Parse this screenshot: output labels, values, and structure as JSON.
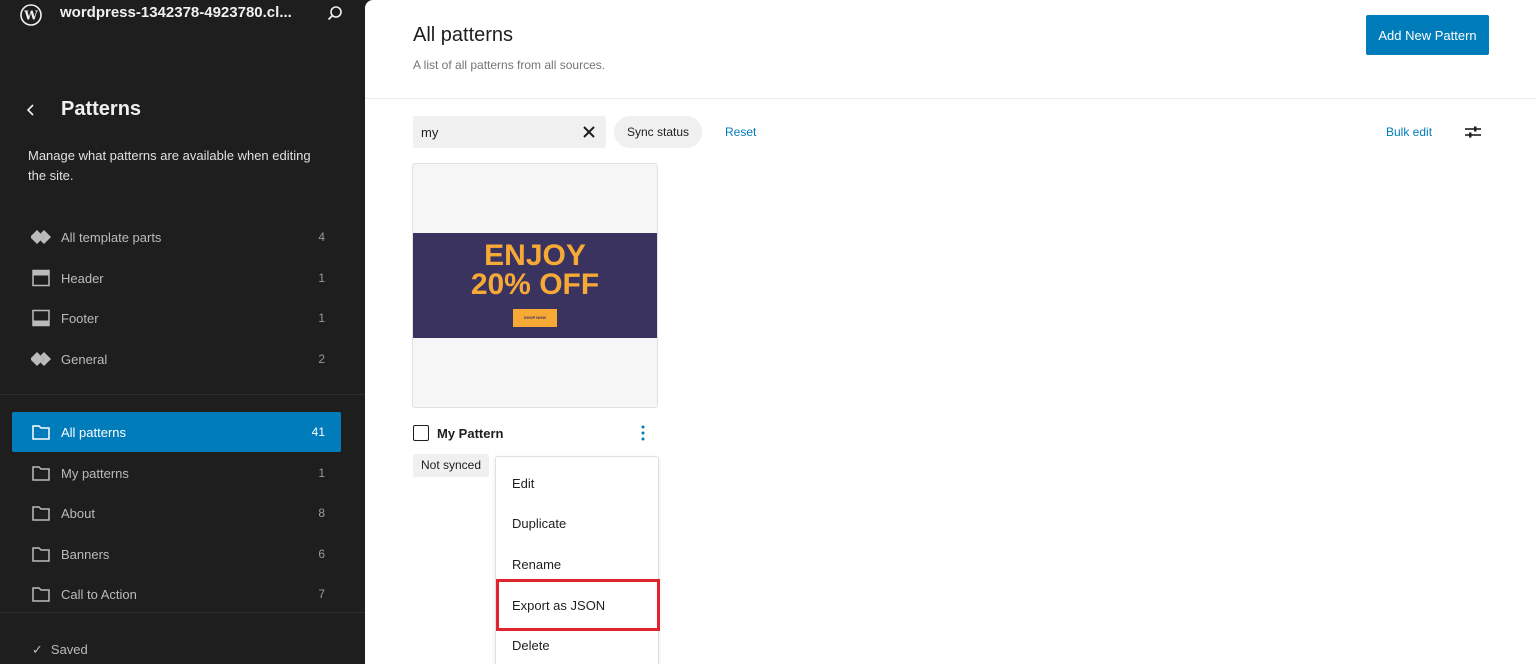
{
  "sidebar": {
    "site_title": "wordpress-1342378-4923780.cl...",
    "title": "Patterns",
    "description": "Manage what patterns are available when editing the site.",
    "template_parts": [
      {
        "label": "All template parts",
        "count": "4",
        "icon": "template-parts-icon"
      },
      {
        "label": "Header",
        "count": "1",
        "icon": "header-icon"
      },
      {
        "label": "Footer",
        "count": "1",
        "icon": "footer-icon"
      },
      {
        "label": "General",
        "count": "2",
        "icon": "template-parts-icon"
      }
    ],
    "pattern_categories": [
      {
        "label": "All patterns",
        "count": "41",
        "icon": "folder-icon",
        "active": true
      },
      {
        "label": "My patterns",
        "count": "1",
        "icon": "folder-icon"
      },
      {
        "label": "About",
        "count": "8",
        "icon": "folder-icon"
      },
      {
        "label": "Banners",
        "count": "6",
        "icon": "folder-icon"
      },
      {
        "label": "Call to Action",
        "count": "7",
        "icon": "folder-icon"
      }
    ],
    "saved_label": "Saved"
  },
  "main": {
    "title": "All patterns",
    "subtitle": "A list of all patterns from all sources.",
    "add_button": "Add New Pattern",
    "search_value": "my",
    "sync_status": "Sync status",
    "reset": "Reset",
    "bulk_edit": "Bulk edit",
    "card": {
      "preview_line1": "ENJOY",
      "preview_line2": "20% OFF",
      "preview_button": "SHOP NOW",
      "name": "My Pattern",
      "badge": "Not synced"
    },
    "menu": [
      "Edit",
      "Duplicate",
      "Rename",
      "Export as JSON",
      "Delete"
    ],
    "highlighted_menu_item": "Export as JSON"
  },
  "colors": {
    "accent": "#007cba",
    "sidebar_bg": "#1e1e1e",
    "banner_bg": "#3a3360",
    "banner_text": "#f7a935",
    "highlight": "#e0232c"
  }
}
